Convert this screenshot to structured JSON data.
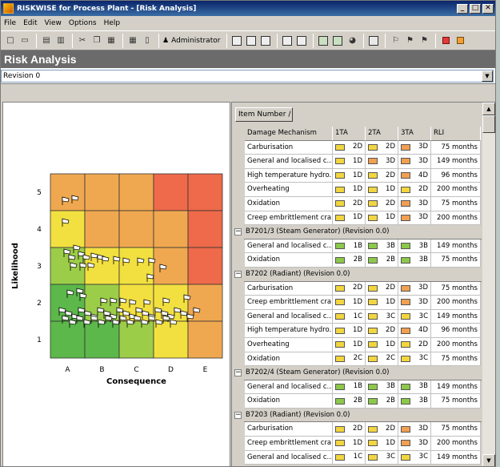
{
  "window": {
    "title": "RISKWISE for Process Plant - [Risk Analysis]",
    "min": "_",
    "max": "□",
    "close": "✕"
  },
  "menu": [
    "File",
    "Edit",
    "View",
    "Options",
    "Help"
  ],
  "toolbar": {
    "user": "Administrator"
  },
  "header": {
    "title": "Risk Analysis"
  },
  "revision": {
    "value": "Revision 0"
  },
  "matrix": {
    "ylabel": "Likelihood",
    "xlabel": "Consequence",
    "rows": [
      "5",
      "4",
      "3",
      "2",
      "1"
    ],
    "cols": [
      "A",
      "B",
      "C",
      "D",
      "E"
    ],
    "colors": [
      [
        "#f0a850",
        "#f0a850",
        "#f0a850",
        "#ee6a4a",
        "#ee6a4a"
      ],
      [
        "#f2e040",
        "#f0a850",
        "#f0a850",
        "#f0a850",
        "#ee6a4a"
      ],
      [
        "#9ccd48",
        "#f2e040",
        "#f2e040",
        "#f0a850",
        "#ee6a4a"
      ],
      [
        "#5cb84a",
        "#9ccd48",
        "#f2e040",
        "#f2e040",
        "#f0a850"
      ],
      [
        "#5cb84a",
        "#5cb84a",
        "#9ccd48",
        "#f2e040",
        "#f0a850"
      ]
    ]
  },
  "table": {
    "item_header": "Item Number /",
    "columns": [
      "Damage Mechanism",
      "1TA",
      "2TA",
      "3TA",
      "RLI"
    ],
    "rows": [
      {
        "type": "d",
        "m": "Carburisation",
        "a": [
          "2D",
          "2D",
          "3D"
        ],
        "c": [
          "#f2d640",
          "#f2d640",
          "#f0a050"
        ],
        "rli": "75 months"
      },
      {
        "type": "d",
        "m": "General and localised c...",
        "a": [
          "1D",
          "3D",
          "3D"
        ],
        "c": [
          "#f2d640",
          "#f0a050",
          "#f0a050"
        ],
        "rli": "149 months"
      },
      {
        "type": "d",
        "m": "High temperature hydro...",
        "a": [
          "1D",
          "2D",
          "4D"
        ],
        "c": [
          "#f2d640",
          "#f2d640",
          "#f0a050"
        ],
        "rli": "96 months"
      },
      {
        "type": "d",
        "m": "Overheating",
        "a": [
          "1D",
          "1D",
          "2D"
        ],
        "c": [
          "#f2d640",
          "#f2d640",
          "#f2d640"
        ],
        "rli": "200 months"
      },
      {
        "type": "d",
        "m": "Oxidation",
        "a": [
          "2D",
          "2D",
          "3D"
        ],
        "c": [
          "#f2d640",
          "#f2d640",
          "#f0a050"
        ],
        "rli": "75 months"
      },
      {
        "type": "d",
        "m": "Creep embrittlement cra...",
        "a": [
          "1D",
          "1D",
          "3D"
        ],
        "c": [
          "#f2d640",
          "#f2d640",
          "#f0a050"
        ],
        "rli": "200 months"
      },
      {
        "type": "g",
        "t": "B7201/3 (Steam Generator) (Revision 0.0)"
      },
      {
        "type": "d",
        "m": "General and localised c...",
        "a": [
          "1B",
          "3B",
          "3B"
        ],
        "c": [
          "#8cc84a",
          "#8cc84a",
          "#8cc84a"
        ],
        "rli": "149 months"
      },
      {
        "type": "d",
        "m": "Oxidation",
        "a": [
          "2B",
          "2B",
          "3B"
        ],
        "c": [
          "#8cc84a",
          "#8cc84a",
          "#8cc84a"
        ],
        "rli": "75 months"
      },
      {
        "type": "g",
        "t": "B7202 (Radiant) (Revision 0.0)"
      },
      {
        "type": "d",
        "m": "Carburisation",
        "a": [
          "2D",
          "2D",
          "3D"
        ],
        "c": [
          "#f2d640",
          "#f2d640",
          "#f0a050"
        ],
        "rli": "75 months"
      },
      {
        "type": "d",
        "m": "Creep embrittlement cra...",
        "a": [
          "1D",
          "1D",
          "3D"
        ],
        "c": [
          "#f2d640",
          "#f2d640",
          "#f0a050"
        ],
        "rli": "200 months"
      },
      {
        "type": "d",
        "m": "General and localised c...",
        "a": [
          "1C",
          "3C",
          "3C"
        ],
        "c": [
          "#f2d640",
          "#f2d640",
          "#f2d640"
        ],
        "rli": "149 months"
      },
      {
        "type": "d",
        "m": "High temperature hydro...",
        "a": [
          "1D",
          "2D",
          "4D"
        ],
        "c": [
          "#f2d640",
          "#f2d640",
          "#f0a050"
        ],
        "rli": "96 months"
      },
      {
        "type": "d",
        "m": "Overheating",
        "a": [
          "1D",
          "1D",
          "2D"
        ],
        "c": [
          "#f2d640",
          "#f2d640",
          "#f2d640"
        ],
        "rli": "200 months"
      },
      {
        "type": "d",
        "m": "Oxidation",
        "a": [
          "2C",
          "2C",
          "3C"
        ],
        "c": [
          "#f2d640",
          "#f2d640",
          "#f2d640"
        ],
        "rli": "75 months"
      },
      {
        "type": "g",
        "t": "B7202/4 (Steam Generator) (Revision 0.0)"
      },
      {
        "type": "d",
        "m": "General and localised c...",
        "a": [
          "1B",
          "3B",
          "3B"
        ],
        "c": [
          "#8cc84a",
          "#8cc84a",
          "#8cc84a"
        ],
        "rli": "149 months"
      },
      {
        "type": "d",
        "m": "Oxidation",
        "a": [
          "2B",
          "2B",
          "3B"
        ],
        "c": [
          "#8cc84a",
          "#8cc84a",
          "#8cc84a"
        ],
        "rli": "75 months"
      },
      {
        "type": "g",
        "t": "B7203 (Radiant) (Revision 0.0)"
      },
      {
        "type": "d",
        "m": "Carburisation",
        "a": [
          "2D",
          "2D",
          "3D"
        ],
        "c": [
          "#f2d640",
          "#f2d640",
          "#f0a050"
        ],
        "rli": "75 months"
      },
      {
        "type": "d",
        "m": "Creep embrittlement cra...",
        "a": [
          "1D",
          "1D",
          "3D"
        ],
        "c": [
          "#f2d640",
          "#f2d640",
          "#f0a050"
        ],
        "rli": "200 months"
      },
      {
        "type": "d",
        "m": "General and localised c...",
        "a": [
          "1C",
          "3C",
          "3C"
        ],
        "c": [
          "#f2d640",
          "#f2d640",
          "#f2d640"
        ],
        "rli": "149 months"
      }
    ]
  }
}
